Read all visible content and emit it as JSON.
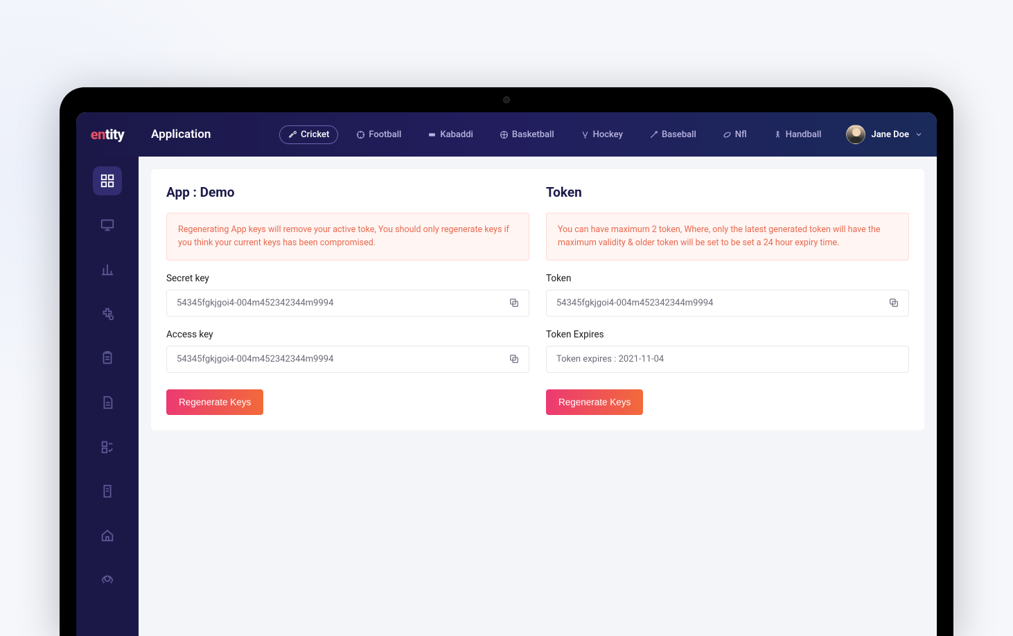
{
  "brand": "entity",
  "page_title": "Application",
  "sports": {
    "cricket": "Cricket",
    "football": "Football",
    "kabaddi": "Kabaddi",
    "basketball": "Basketball",
    "hockey": "Hockey",
    "baseball": "Baseball",
    "nfl": "Nfl",
    "handball": "Handball"
  },
  "user": {
    "name": "Jane Doe"
  },
  "left": {
    "title": "App : Demo",
    "warning": "Regenerating App keys will remove your active toke, You should only regenerate keys if you think your current keys has been compromised.",
    "secret_label": "Secret key",
    "secret_value": "54345fgkjgoi4-004m452342344m9994",
    "access_label": "Access key",
    "access_value": "54345fgkjgoi4-004m452342344m9994",
    "button": "Regenerate Keys"
  },
  "right": {
    "title": "Token",
    "warning": "You can have maximum 2 token, Where, only the latest generated token will have the maximum validity & older token will be set to be set a 24 hour expiry time.",
    "token_label": "Token",
    "token_value": "54345fgkjgoi4-004m452342344m9994",
    "expires_label": "Token Expires",
    "expires_value": "Token expires : 2021-11-04",
    "button": "Regenerate Keys"
  }
}
